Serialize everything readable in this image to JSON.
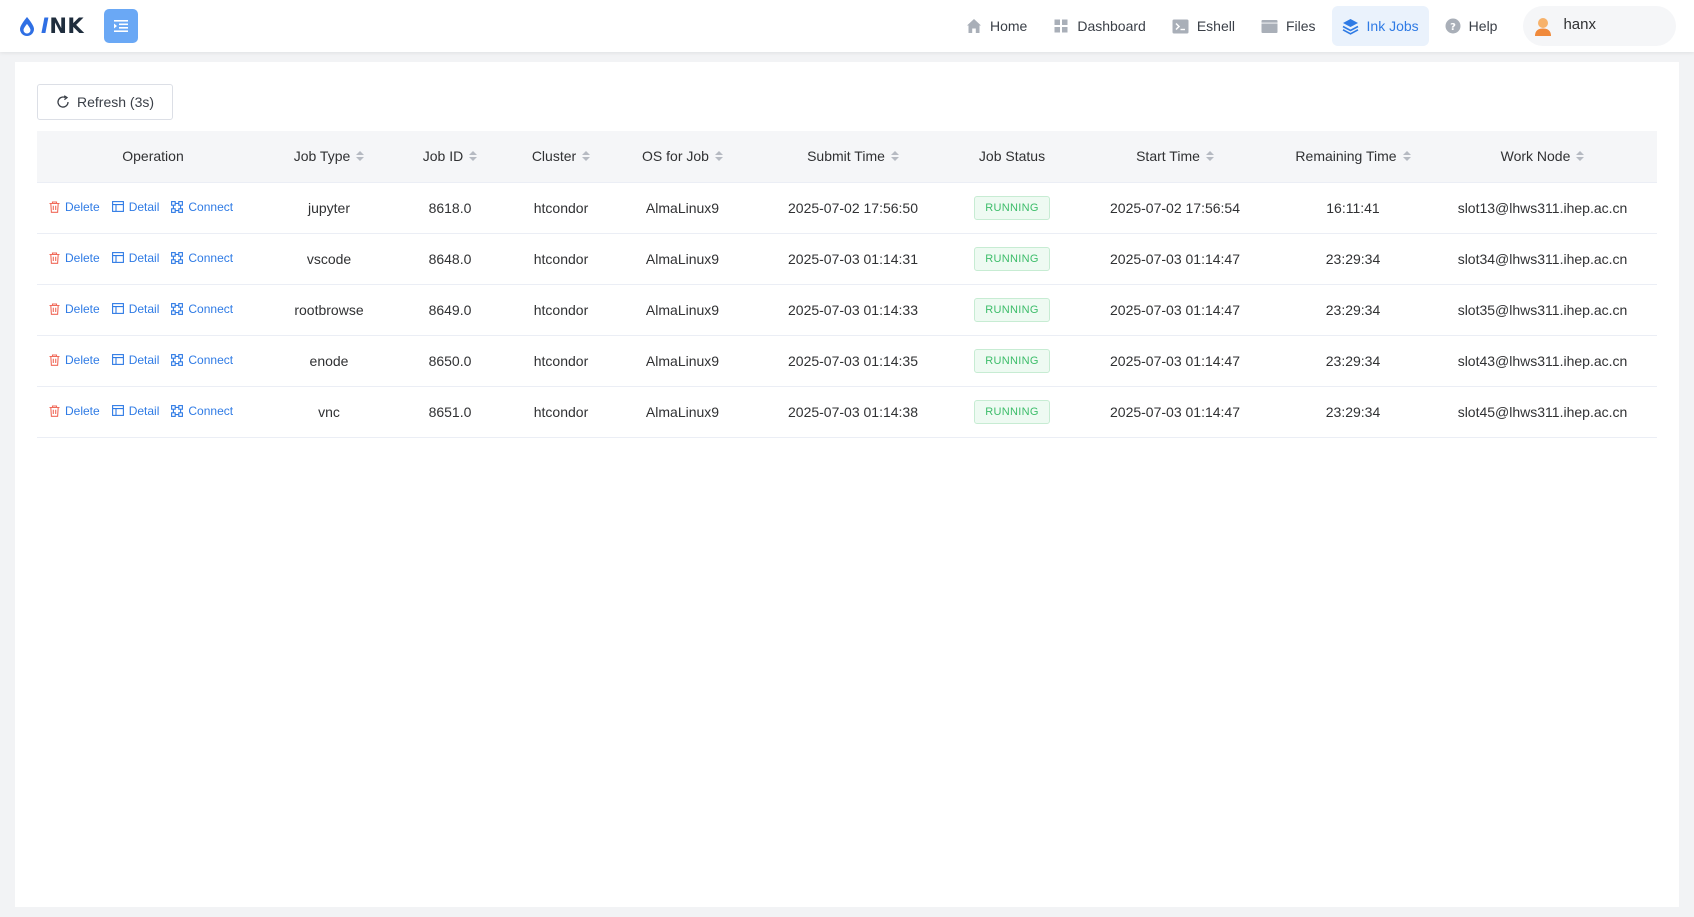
{
  "app": {
    "logo_text_i": "I",
    "logo_text_rest": "NK"
  },
  "nav": [
    {
      "label": "Home",
      "icon": "home-icon"
    },
    {
      "label": "Dashboard",
      "icon": "dashboard-icon"
    },
    {
      "label": "Eshell",
      "icon": "terminal-icon"
    },
    {
      "label": "Files",
      "icon": "folder-icon"
    },
    {
      "label": "Ink Jobs",
      "icon": "layers-icon",
      "active": true
    },
    {
      "label": "Help",
      "icon": "help-icon"
    }
  ],
  "user": {
    "name": "hanx"
  },
  "toolbar": {
    "refresh_label": "Refresh (3s)"
  },
  "table": {
    "headers": {
      "operation": "Operation",
      "job_type": "Job Type",
      "job_id": "Job ID",
      "cluster": "Cluster",
      "os": "OS for Job",
      "submit_time": "Submit Time",
      "job_status": "Job Status",
      "start_time": "Start Time",
      "remaining_time": "Remaining Time",
      "work_node": "Work Node"
    },
    "actions": {
      "delete": "Delete",
      "detail": "Detail",
      "connect": "Connect"
    },
    "rows": [
      {
        "job_type": "jupyter",
        "job_id": "8618.0",
        "cluster": "htcondor",
        "os": "AlmaLinux9",
        "submit_time": "2025-07-02 17:56:50",
        "status": "RUNNING",
        "start_time": "2025-07-02 17:56:54",
        "remaining_time": "16:11:41",
        "work_node": "slot13@lhws311.ihep.ac.cn"
      },
      {
        "job_type": "vscode",
        "job_id": "8648.0",
        "cluster": "htcondor",
        "os": "AlmaLinux9",
        "submit_time": "2025-07-03 01:14:31",
        "status": "RUNNING",
        "start_time": "2025-07-03 01:14:47",
        "remaining_time": "23:29:34",
        "work_node": "slot34@lhws311.ihep.ac.cn"
      },
      {
        "job_type": "rootbrowse",
        "job_id": "8649.0",
        "cluster": "htcondor",
        "os": "AlmaLinux9",
        "submit_time": "2025-07-03 01:14:33",
        "status": "RUNNING",
        "start_time": "2025-07-03 01:14:47",
        "remaining_time": "23:29:34",
        "work_node": "slot35@lhws311.ihep.ac.cn"
      },
      {
        "job_type": "enode",
        "job_id": "8650.0",
        "cluster": "htcondor",
        "os": "AlmaLinux9",
        "submit_time": "2025-07-03 01:14:35",
        "status": "RUNNING",
        "start_time": "2025-07-03 01:14:47",
        "remaining_time": "23:29:34",
        "work_node": "slot43@lhws311.ihep.ac.cn"
      },
      {
        "job_type": "vnc",
        "job_id": "8651.0",
        "cluster": "htcondor",
        "os": "AlmaLinux9",
        "submit_time": "2025-07-03 01:14:38",
        "status": "RUNNING",
        "start_time": "2025-07-03 01:14:47",
        "remaining_time": "23:29:34",
        "work_node": "slot45@lhws311.ihep.ac.cn"
      }
    ]
  },
  "colors": {
    "accent": "#2f7be5",
    "danger": "#f06a5a",
    "success": "#3dbd6a",
    "toggle": "#6aa8f5"
  }
}
